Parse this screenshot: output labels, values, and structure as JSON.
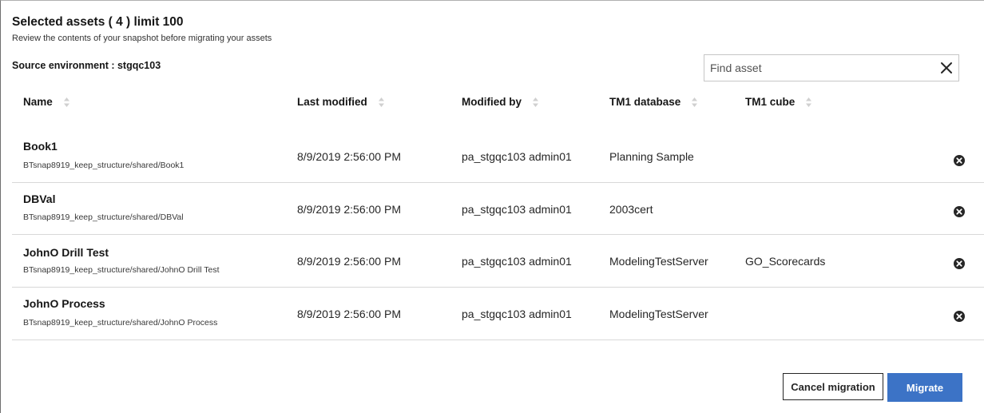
{
  "dialog": {
    "title": "Selected assets ( 4 ) limit 100",
    "subtitle": "Review the contents of your snapshot before migrating your assets",
    "source_environment": "Source environment : stgqc103"
  },
  "search": {
    "placeholder": "Find asset",
    "value": ""
  },
  "table": {
    "columns": [
      {
        "label": "Name",
        "sortable": true
      },
      {
        "label": "Last modified",
        "sortable": true
      },
      {
        "label": "Modified by",
        "sortable": true
      },
      {
        "label": "TM1 database",
        "sortable": true
      },
      {
        "label": "TM1 cube",
        "sortable": true
      }
    ],
    "rows": [
      {
        "name": "Book1",
        "path": "BTsnap8919_keep_structure/shared/Book1",
        "last_modified": "8/9/2019 2:56:00 PM",
        "modified_by": "pa_stgqc103 admin01",
        "tm1_database": "Planning Sample",
        "tm1_cube": ""
      },
      {
        "name": "DBVal",
        "path": "BTsnap8919_keep_structure/shared/DBVal",
        "last_modified": "8/9/2019 2:56:00 PM",
        "modified_by": "pa_stgqc103 admin01",
        "tm1_database": "2003cert",
        "tm1_cube": ""
      },
      {
        "name": "JohnO Drill Test",
        "path": "BTsnap8919_keep_structure/shared/JohnO Drill Test",
        "last_modified": "8/9/2019 2:56:00 PM",
        "modified_by": "pa_stgqc103 admin01",
        "tm1_database": "ModelingTestServer",
        "tm1_cube": "GO_Scorecards"
      },
      {
        "name": "JohnO Process",
        "path": "BTsnap8919_keep_structure/shared/JohnO Process",
        "last_modified": "8/9/2019 2:56:00 PM",
        "modified_by": "pa_stgqc103 admin01",
        "tm1_database": "ModelingTestServer",
        "tm1_cube": ""
      }
    ]
  },
  "icons": {
    "clear": "close-icon",
    "sort": "sort-arrows-icon",
    "remove": "remove-circle-icon"
  },
  "actions": {
    "cancel_label": "Cancel migration",
    "migrate_label": "Migrate"
  },
  "colors": {
    "primary": "#3c73c6",
    "text": "#161616",
    "divider": "#d8d8d8"
  }
}
